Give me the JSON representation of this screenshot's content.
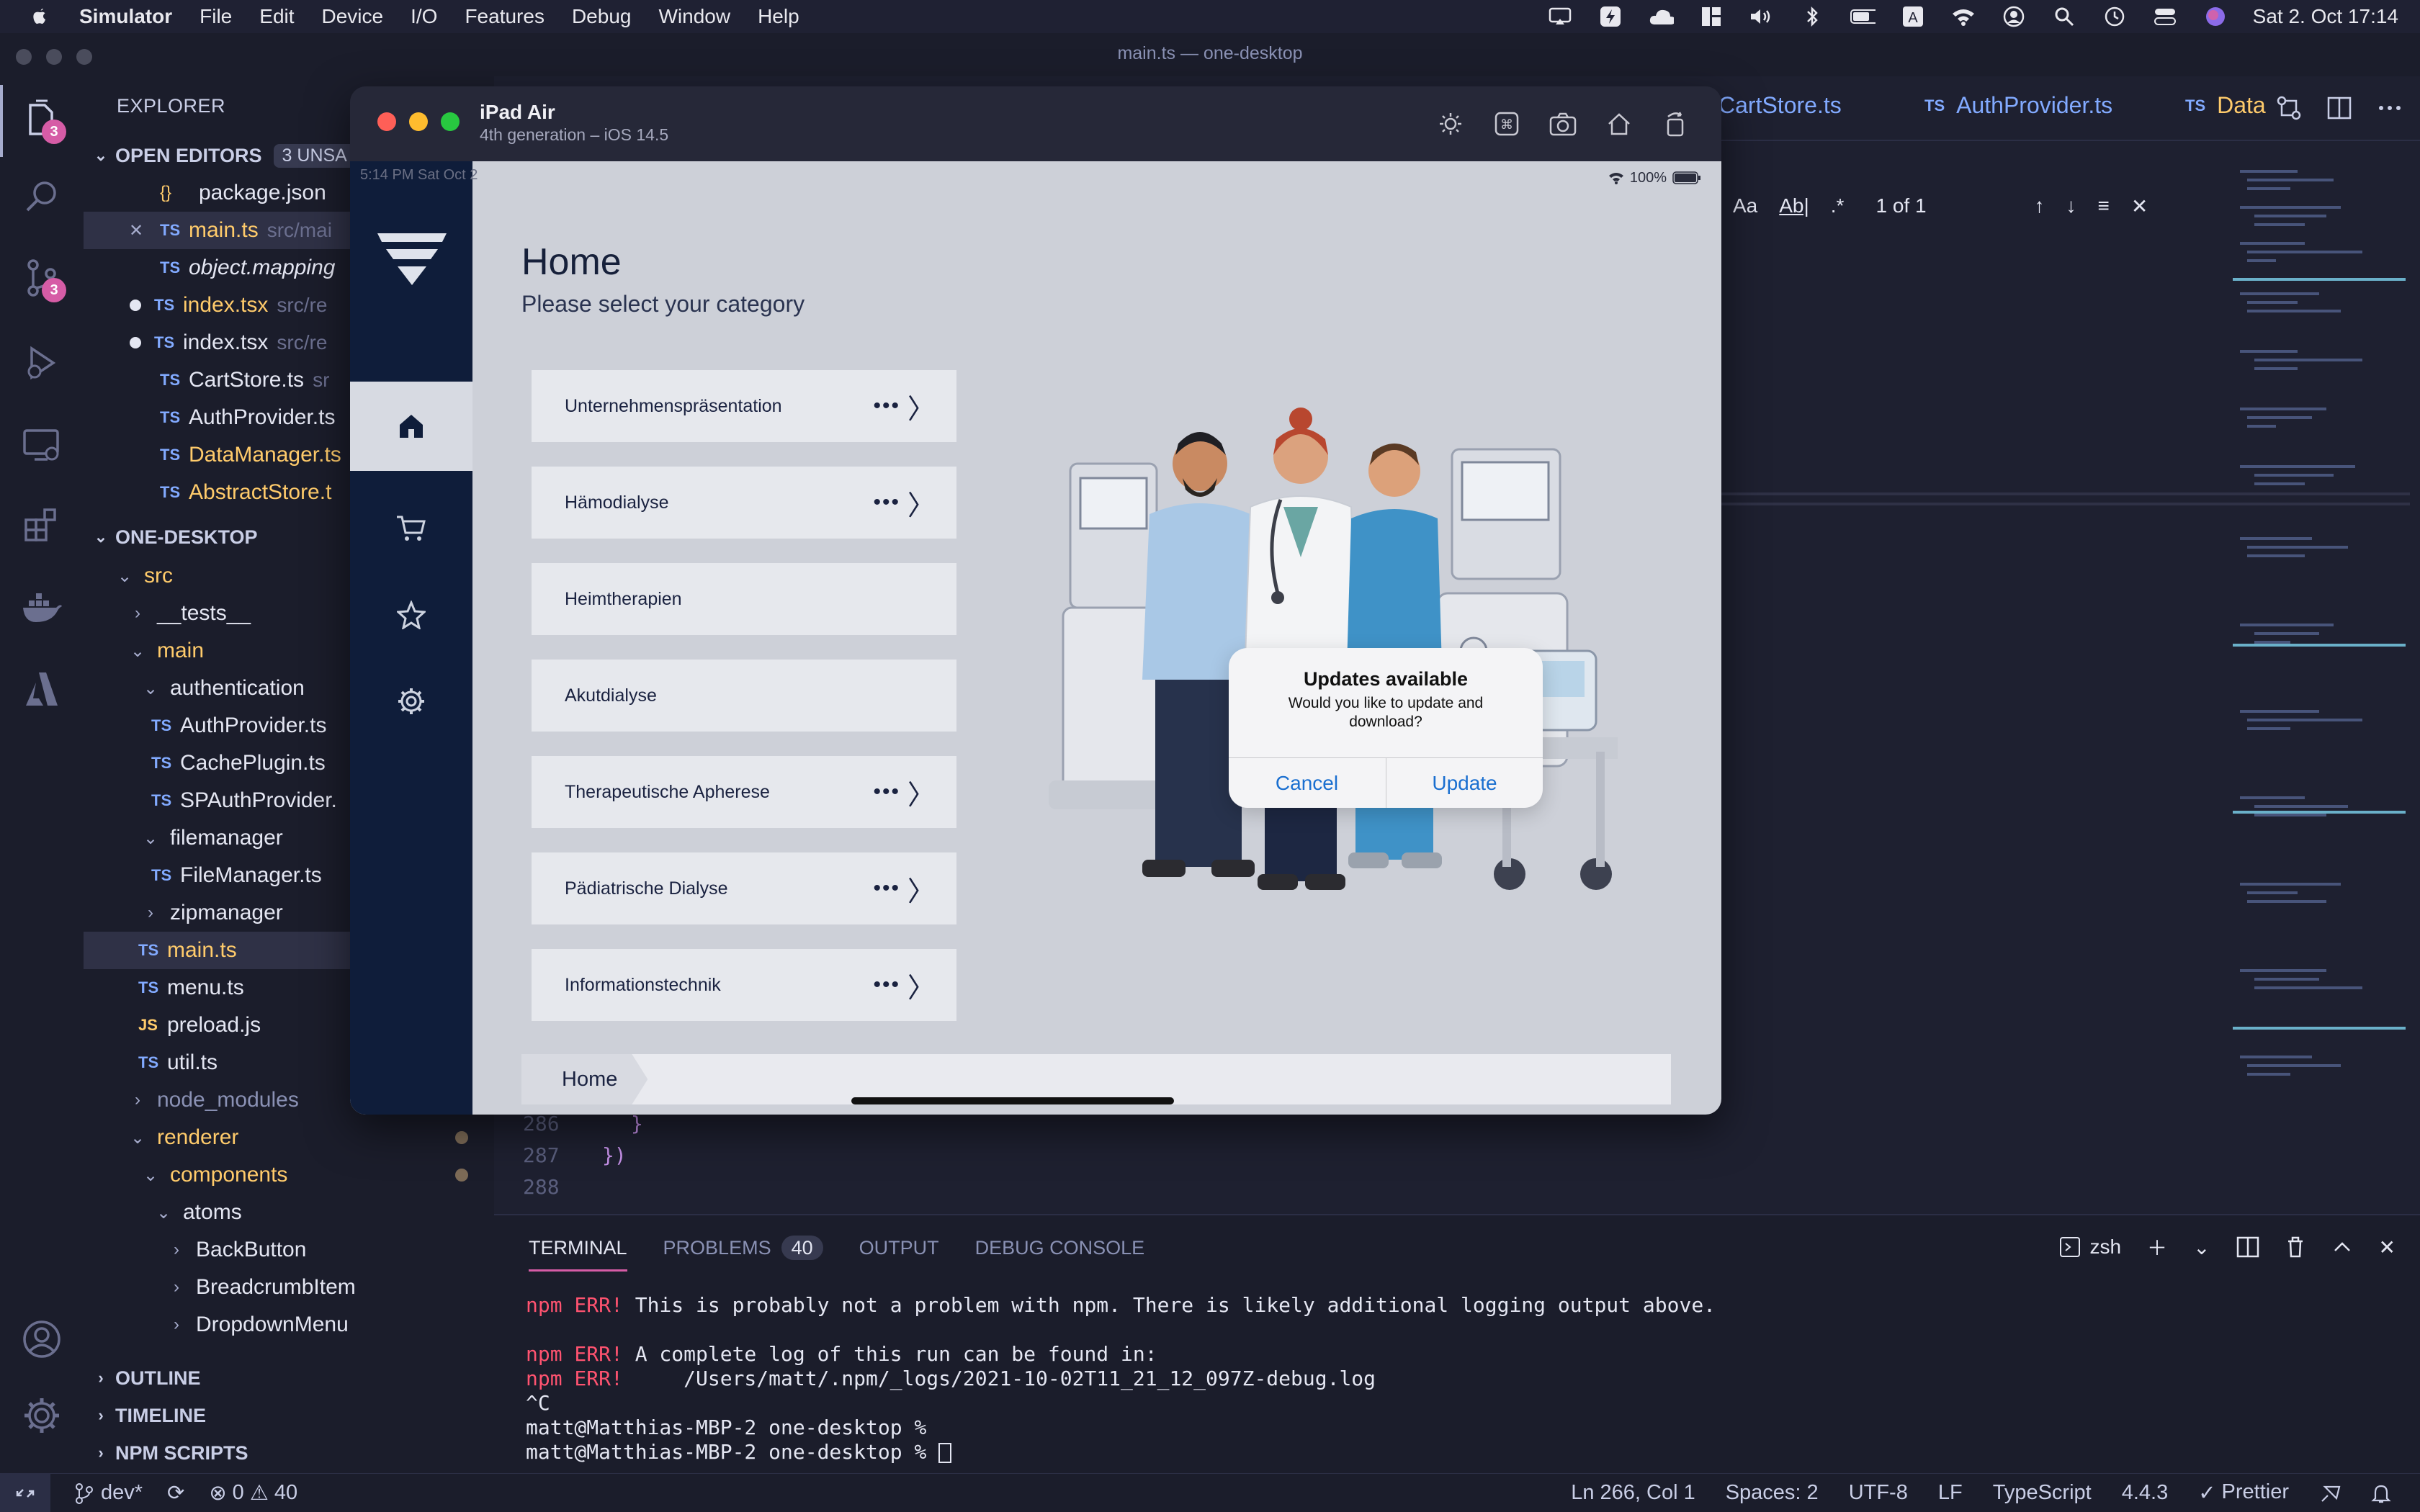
{
  "menubar": {
    "app": "Simulator",
    "items": [
      "File",
      "Edit",
      "Device",
      "I/O",
      "Features",
      "Debug",
      "Window",
      "Help"
    ],
    "clock": "Sat 2. Oct  17:14"
  },
  "window": {
    "title": "main.ts — one-desktop"
  },
  "activity": {
    "explorer_badge": "3",
    "scm_badge": "3"
  },
  "explorer": {
    "header": "EXPLORER",
    "open_editors_label": "OPEN EDITORS",
    "unsaved_label": "3 UNSA",
    "open_editors": [
      {
        "icon": "{}",
        "name": "package.json",
        "path": ""
      },
      {
        "icon": "TS",
        "name": "main.ts",
        "path": "src/mai"
      },
      {
        "icon": "TS",
        "name": "object.mapping",
        "path": ""
      },
      {
        "icon": "TS",
        "name": "index.tsx",
        "path": "src/re"
      },
      {
        "icon": "TS",
        "name": "index.tsx",
        "path": "src/re"
      },
      {
        "icon": "TS",
        "name": "CartStore.ts",
        "path": "sr"
      },
      {
        "icon": "TS",
        "name": "AuthProvider.ts",
        "path": ""
      },
      {
        "icon": "TS",
        "name": "DataManager.ts",
        "path": ""
      },
      {
        "icon": "TS",
        "name": "AbstractStore.t",
        "path": ""
      }
    ],
    "project_label": "ONE-DESKTOP",
    "tree": [
      {
        "name": "src"
      },
      {
        "name": "__tests__"
      },
      {
        "name": "main"
      },
      {
        "name": "authentication"
      },
      {
        "name": "AuthProvider.ts"
      },
      {
        "name": "CachePlugin.ts"
      },
      {
        "name": "SPAuthProvider."
      },
      {
        "name": "filemanager"
      },
      {
        "name": "FileManager.ts"
      },
      {
        "name": "zipmanager"
      },
      {
        "name": "main.ts"
      },
      {
        "name": "menu.ts"
      },
      {
        "name": "preload.js"
      },
      {
        "name": "util.ts"
      },
      {
        "name": "node_modules"
      },
      {
        "name": "renderer"
      },
      {
        "name": "components"
      },
      {
        "name": "atoms"
      },
      {
        "name": "BackButton"
      },
      {
        "name": "BreadcrumbItem"
      },
      {
        "name": "DropdownMenu"
      }
    ],
    "outline_label": "OUTLINE",
    "timeline_label": "TIMELINE",
    "npm_label": "NPM SCRIPTS"
  },
  "editor": {
    "tabs": [
      "CartStore.ts",
      "AuthProvider.ts",
      "Data"
    ],
    "find": {
      "aa": "Aa",
      "ab": "Ab|",
      "regex": ".*",
      "result": "1 of 1"
    },
    "lines": [
      {
        "num": "286",
        "code": "  }"
      },
      {
        "num": "287",
        "code": "})"
      },
      {
        "num": "288",
        "code": ""
      }
    ]
  },
  "panel": {
    "tabs": [
      "TERMINAL",
      "PROBLEMS",
      "OUTPUT",
      "DEBUG CONSOLE"
    ],
    "problems_count": "40",
    "shell": "zsh",
    "terminal": {
      "l1_err": "npm ERR!",
      "l1_text": " This is probably not a problem with npm. There is likely additional logging output above.",
      "l2_err": "npm ERR!",
      "l2_text": " A complete log of this run can be found in:",
      "l3_err": "npm ERR!",
      "l3_text": "     /Users/matt/.npm/_logs/2021-10-02T11_21_12_097Z-debug.log",
      "l4": "^C",
      "l5": "matt@Matthias-MBP-2 one-desktop %",
      "l6": "matt@Matthias-MBP-2 one-desktop %"
    }
  },
  "statusbar": {
    "branch": "dev*",
    "errors": "0",
    "warnings": "40",
    "position": "Ln 266, Col 1",
    "spaces": "Spaces: 2",
    "encoding": "UTF-8",
    "eol": "LF",
    "language": "TypeScript",
    "version": "4.4.3",
    "formatter": "Prettier"
  },
  "simulator": {
    "device": "iPad Air",
    "subtitle": "4th generation – iOS 14.5",
    "ios_time": "5:14 PM   Sat Oct 2",
    "battery": "100%",
    "home_title": "Home",
    "home_subtitle": "Please select your category",
    "categories": [
      "Unternehmenspräsentation",
      "Hämodialyse",
      "Heimtherapien",
      "Akutdialyse",
      "Therapeutische Apherese",
      "Pädiatrische Dialyse",
      "Informationstechnik"
    ],
    "more": "•••",
    "chevron": "〉",
    "breadcrumb": "Home",
    "alert": {
      "title": "Updates available",
      "message": "Would you like to update and download?",
      "cancel": "Cancel",
      "update": "Update"
    }
  },
  "colors": {
    "accent": "#d65ca6",
    "ts_blue": "#82aaff",
    "modified_yellow": "#ffcb6b",
    "ipad_nav": "#0f1d3a",
    "alert_button": "#1a6fd0"
  }
}
